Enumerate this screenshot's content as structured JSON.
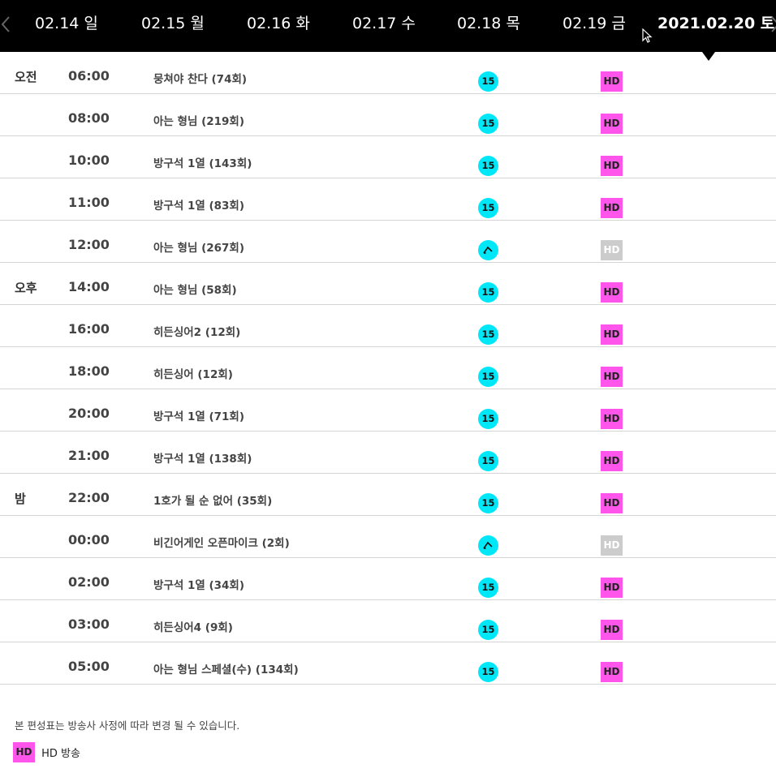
{
  "datebar": {
    "tabs": [
      {
        "label": "02.14 일"
      },
      {
        "label": "02.15 월"
      },
      {
        "label": "02.16 화"
      },
      {
        "label": "02.17 수"
      },
      {
        "label": "02.18 목"
      },
      {
        "label": "02.19 금"
      },
      {
        "label": "2021.02.20 토"
      }
    ],
    "selected_index": 6
  },
  "schedule": [
    {
      "period": "오전",
      "time": "06:00",
      "title": "뭉쳐야 찬다 (74회)",
      "rating": "15",
      "hd": "HD",
      "hd_active": true
    },
    {
      "period": "",
      "time": "08:00",
      "title": "아는 형님 (219회)",
      "rating": "15",
      "hd": "HD",
      "hd_active": true
    },
    {
      "period": "",
      "time": "10:00",
      "title": "방구석 1열 (143회)",
      "rating": "15",
      "hd": "HD",
      "hd_active": true
    },
    {
      "period": "",
      "time": "11:00",
      "title": "방구석 1열 (83회)",
      "rating": "15",
      "hd": "HD",
      "hd_active": true
    },
    {
      "period": "",
      "time": "12:00",
      "title": "아는 형님 (267회)",
      "rating": "",
      "rating_icon": "rerun-icon",
      "hd": "HD",
      "hd_active": false
    },
    {
      "period": "오후",
      "time": "14:00",
      "title": "아는 형님 (58회)",
      "rating": "15",
      "hd": "HD",
      "hd_active": true
    },
    {
      "period": "",
      "time": "16:00",
      "title": "히든싱어2 (12회)",
      "rating": "15",
      "hd": "HD",
      "hd_active": true
    },
    {
      "period": "",
      "time": "18:00",
      "title": "히든싱어 (12회)",
      "rating": "15",
      "hd": "HD",
      "hd_active": true
    },
    {
      "period": "",
      "time": "20:00",
      "title": "방구석 1열 (71회)",
      "rating": "15",
      "hd": "HD",
      "hd_active": true
    },
    {
      "period": "",
      "time": "21:00",
      "title": "방구석 1열 (138회)",
      "rating": "15",
      "hd": "HD",
      "hd_active": true
    },
    {
      "period": "밤",
      "time": "22:00",
      "title": "1호가 될 순 없어 (35회)",
      "rating": "15",
      "hd": "HD",
      "hd_active": true
    },
    {
      "period": "",
      "time": "00:00",
      "title": "비긴어게인 오픈마이크 (2회)",
      "rating": "",
      "rating_icon": "rerun-icon",
      "hd": "HD",
      "hd_active": false
    },
    {
      "period": "",
      "time": "02:00",
      "title": "방구석 1열 (34회)",
      "rating": "15",
      "hd": "HD",
      "hd_active": true
    },
    {
      "period": "",
      "time": "03:00",
      "title": "히든싱어4 (9회)",
      "rating": "15",
      "hd": "HD",
      "hd_active": true
    },
    {
      "period": "",
      "time": "05:00",
      "title": "아는 형님 스페셜(수) (134회)",
      "rating": "15",
      "hd": "HD",
      "hd_active": true
    }
  ],
  "footer": {
    "notice": "본 편성표는 방송사 사정에 따라 변경 될 수 있습니다.",
    "legend_badge": "HD",
    "legend_text": "HD 방송"
  },
  "colors": {
    "rating_badge": "#00e8f8",
    "hd_badge": "#ff55ea",
    "hd_inactive": "#cccccc",
    "header_bg": "#000000"
  }
}
